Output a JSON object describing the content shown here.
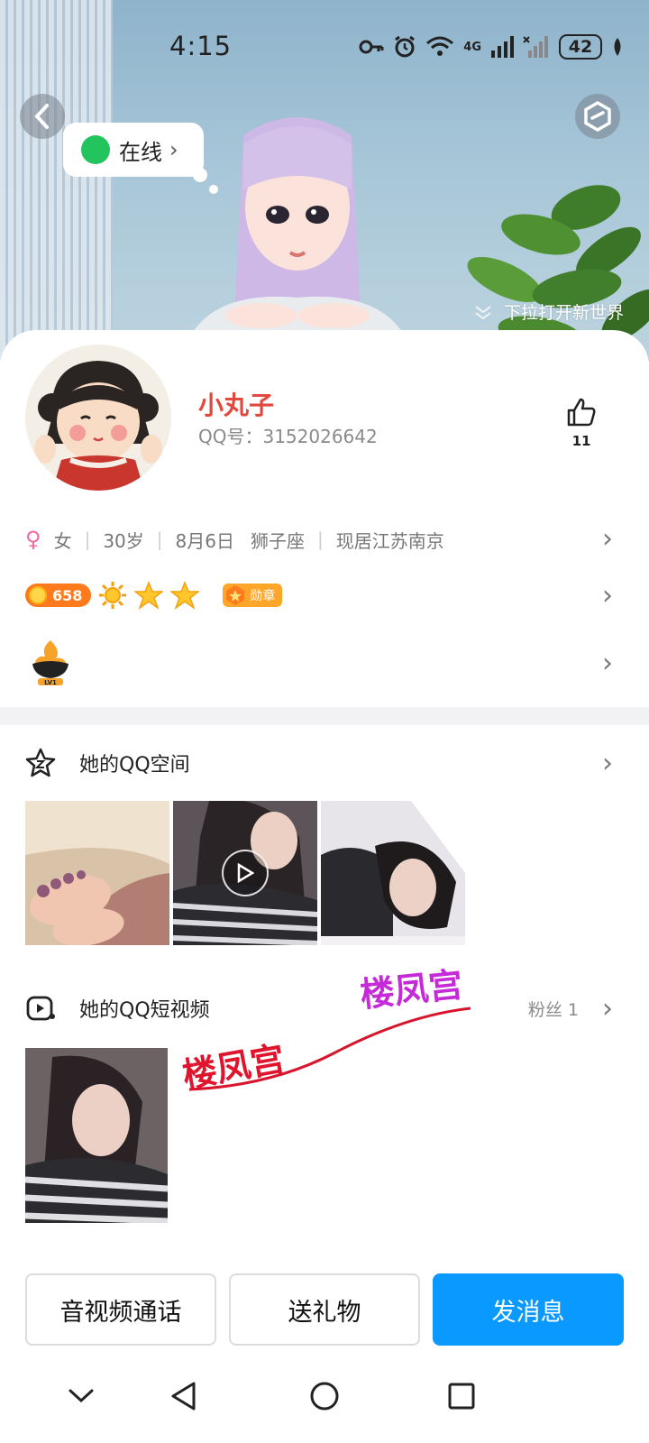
{
  "status_bar": {
    "time": "4:15",
    "network": "4G",
    "battery": "42"
  },
  "header": {
    "online_status": "在线",
    "pulldown_hint": "下拉打开新世界"
  },
  "profile": {
    "nickname": "小丸子",
    "qq_number": "QQ号：3152026642",
    "likes": "11",
    "gender": "女",
    "age": "30岁",
    "birthday": "8月6日",
    "zodiac": "狮子座",
    "location": "现居江苏南京",
    "coin_level": "658",
    "medal_label": "勋章",
    "level_label": "LV1"
  },
  "qzone": {
    "title": "她的QQ空间",
    "photos": [
      "feet-photo",
      "video-photo",
      "selfie-photo"
    ]
  },
  "shortvideo": {
    "title": "她的QQ短视频",
    "fans": "粉丝 1"
  },
  "watermark": {
    "text1": "楼凤宫",
    "text2": "楼凤宫"
  },
  "actions": {
    "call": "音视频通话",
    "gift": "送礼物",
    "message": "发消息"
  },
  "colors": {
    "accent": "#0a99ff",
    "nickname": "#e2483d",
    "online": "#23c45e"
  }
}
